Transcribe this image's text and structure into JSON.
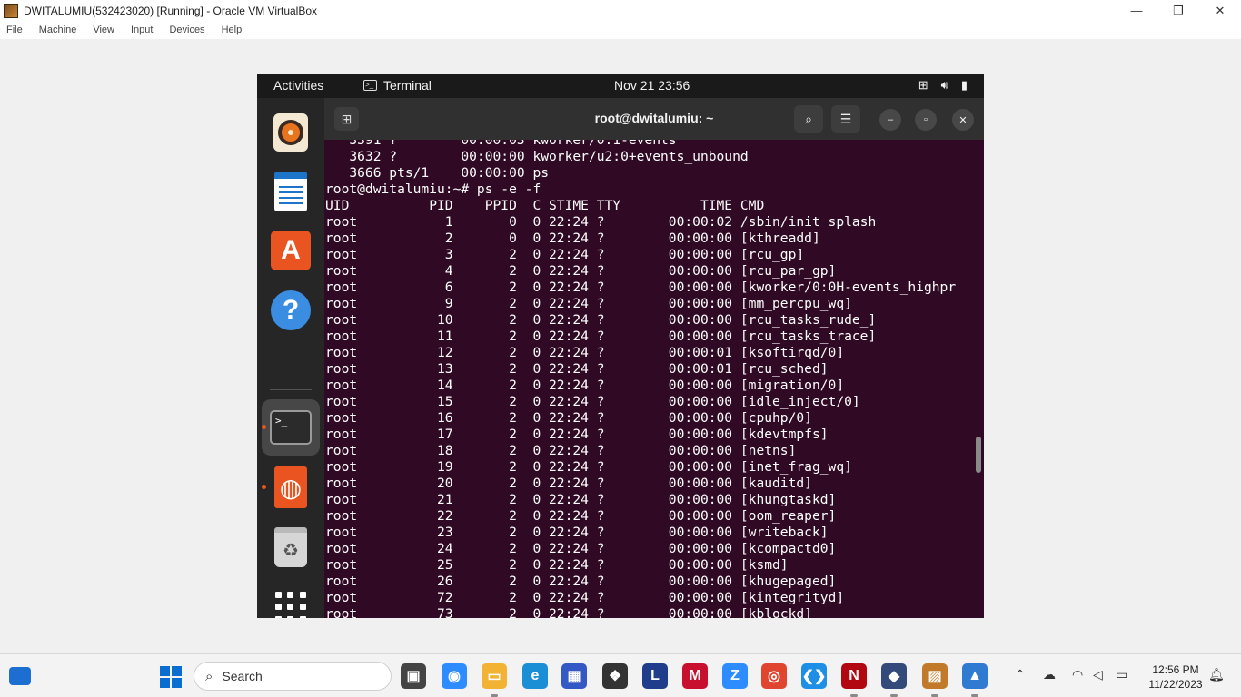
{
  "vbox": {
    "title": "DWITALUMIU(532423020) [Running] - Oracle VM VirtualBox",
    "menu": [
      "File",
      "Machine",
      "View",
      "Input",
      "Devices",
      "Help"
    ],
    "controls": {
      "minimize": "—",
      "restore": "❐",
      "close": "✕"
    }
  },
  "guest_topbar": {
    "activities": "Activities",
    "app_name": "Terminal",
    "clock": "Nov 21  23:56",
    "sys_icons": [
      "network-icon",
      "volume-icon",
      "battery-icon"
    ]
  },
  "dock": {
    "items": [
      "rhythmbox-icon",
      "libreoffice-writer-icon",
      "ubuntu-software-icon",
      "help-icon",
      "terminal-icon",
      "ubuntu-icon",
      "trash-icon",
      "show-apps-icon"
    ],
    "term_prompt_glyph": ">_"
  },
  "terminal": {
    "title": "root@dwitalumiu: ~",
    "lines": [
      "   3391 ?        00:00:03 kworker/0:1-events",
      "   3632 ?        00:00:00 kworker/u2:0+events_unbound",
      "   3666 pts/1    00:00:00 ps",
      "root@dwitalumiu:~# ps -e -f",
      "UID          PID    PPID  C STIME TTY          TIME CMD",
      "root           1       0  0 22:24 ?        00:00:02 /sbin/init splash",
      "root           2       0  0 22:24 ?        00:00:00 [kthreadd]",
      "root           3       2  0 22:24 ?        00:00:00 [rcu_gp]",
      "root           4       2  0 22:24 ?        00:00:00 [rcu_par_gp]",
      "root           6       2  0 22:24 ?        00:00:00 [kworker/0:0H-events_highpr",
      "root           9       2  0 22:24 ?        00:00:00 [mm_percpu_wq]",
      "root          10       2  0 22:24 ?        00:00:00 [rcu_tasks_rude_]",
      "root          11       2  0 22:24 ?        00:00:00 [rcu_tasks_trace]",
      "root          12       2  0 22:24 ?        00:00:01 [ksoftirqd/0]",
      "root          13       2  0 22:24 ?        00:00:01 [rcu_sched]",
      "root          14       2  0 22:24 ?        00:00:00 [migration/0]",
      "root          15       2  0 22:24 ?        00:00:00 [idle_inject/0]",
      "root          16       2  0 22:24 ?        00:00:00 [cpuhp/0]",
      "root          17       2  0 22:24 ?        00:00:00 [kdevtmpfs]",
      "root          18       2  0 22:24 ?        00:00:00 [netns]",
      "root          19       2  0 22:24 ?        00:00:00 [inet_frag_wq]",
      "root          20       2  0 22:24 ?        00:00:00 [kauditd]",
      "root          21       2  0 22:24 ?        00:00:00 [khungtaskd]",
      "root          22       2  0 22:24 ?        00:00:00 [oom_reaper]",
      "root          23       2  0 22:24 ?        00:00:00 [writeback]",
      "root          24       2  0 22:24 ?        00:00:00 [kcompactd0]",
      "root          25       2  0 22:24 ?        00:00:00 [ksmd]",
      "root          26       2  0 22:24 ?        00:00:00 [khugepaged]",
      "root          72       2  0 22:24 ?        00:00:00 [kintegrityd]",
      "root          73       2  0 22:24 ?        00:00:00 [kblockd]"
    ]
  },
  "taskbar": {
    "search_label": "Search",
    "apps": [
      {
        "name": "task-view",
        "glyph": "▣",
        "color": "#444444"
      },
      {
        "name": "zoom-meetings",
        "glyph": "◉",
        "color": "#2d8cff"
      },
      {
        "name": "file-explorer",
        "glyph": "▭",
        "color": "#f2b233"
      },
      {
        "name": "edge",
        "glyph": "e",
        "color": "#1a8fd6"
      },
      {
        "name": "microsoft-store",
        "glyph": "▦",
        "color": "#3458c4"
      },
      {
        "name": "dropbox",
        "glyph": "❖",
        "color": "#333333"
      },
      {
        "name": "l-app",
        "glyph": "L",
        "color": "#1f3d8a"
      },
      {
        "name": "mcafee",
        "glyph": "M",
        "color": "#c8102e"
      },
      {
        "name": "zoom",
        "glyph": "Z",
        "color": "#2d8cff"
      },
      {
        "name": "chrome",
        "glyph": "◎",
        "color": "#e0452f"
      },
      {
        "name": "vscode",
        "glyph": "❮❯",
        "color": "#1f8fe6"
      },
      {
        "name": "netflix",
        "glyph": "N",
        "color": "#b20710"
      },
      {
        "name": "virtualbox",
        "glyph": "◆",
        "color": "#334a7a"
      },
      {
        "name": "virtualbox-vm",
        "glyph": "▨",
        "color": "#c07a2a"
      },
      {
        "name": "photos",
        "glyph": "▲",
        "color": "#2f7bd1"
      }
    ],
    "tray": {
      "time": "12:56 PM",
      "date": "11/22/2023"
    }
  }
}
